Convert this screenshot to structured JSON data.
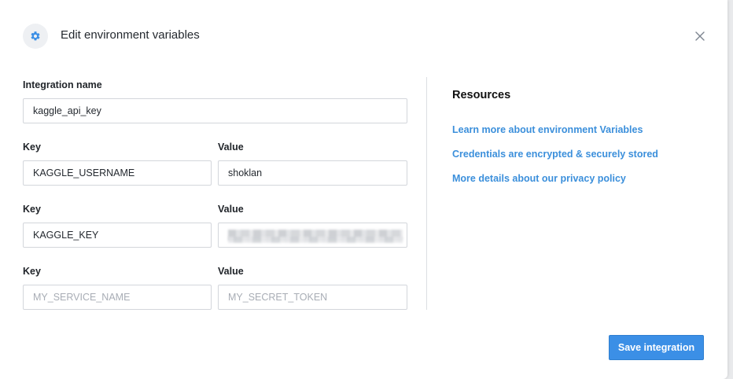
{
  "header": {
    "title": "Edit environment variables",
    "icon": "gear-icon",
    "icon_color": "#3b8fe6",
    "close_icon": "close-icon"
  },
  "form": {
    "integration_name_label": "Integration name",
    "integration_name_value": "kaggle_api_key",
    "rows": [
      {
        "key_label": "Key",
        "value_label": "Value",
        "key": "KAGGLE_USERNAME",
        "value": "shoklan"
      },
      {
        "key_label": "Key",
        "value_label": "Value",
        "key": "KAGGLE_KEY",
        "value_masked": true
      },
      {
        "key_label": "Key",
        "value_label": "Value",
        "key_placeholder": "MY_SERVICE_NAME",
        "value_placeholder": "MY_SECRET_TOKEN"
      }
    ]
  },
  "resources": {
    "title": "Resources",
    "links": [
      "Learn more about environment Variables",
      "Credentials are encrypted & securely stored",
      "More details about our privacy policy"
    ],
    "link_color": "#3b8fdb"
  },
  "footer": {
    "save_label": "Save integration",
    "accent": "#3b8fe6"
  }
}
